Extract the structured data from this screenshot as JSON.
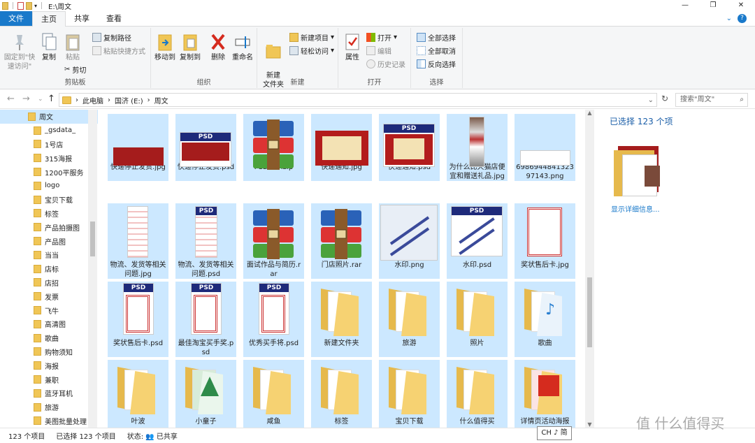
{
  "titlebar": {
    "title": "E:\\周文"
  },
  "tabs": [
    "文件",
    "主页",
    "共享",
    "查看"
  ],
  "ribbon": {
    "clipboard": {
      "label": "剪贴板",
      "pin": "固定到\"快速访问\"",
      "copy": "复制",
      "paste": "粘贴",
      "copy_path": "复制路径",
      "paste_shortcut": "粘贴快捷方式",
      "cut": "剪切"
    },
    "organize": {
      "label": "组织",
      "move_to": "移动到",
      "copy_to": "复制到",
      "delete": "删除",
      "rename": "重命名"
    },
    "new": {
      "label": "新建",
      "new_folder": "新建\n文件夹",
      "new_item": "新建项目",
      "easy_access": "轻松访问"
    },
    "open": {
      "label": "打开",
      "properties": "属性",
      "open": "打开",
      "edit": "编辑",
      "history": "历史记录"
    },
    "select": {
      "label": "选择",
      "select_all": "全部选择",
      "select_none": "全部取消",
      "invert": "反向选择"
    }
  },
  "address": {
    "crumbs": [
      "此电脑",
      "国济 (E:)",
      "周文"
    ],
    "search_placeholder": "搜索\"周文\""
  },
  "sidebar": {
    "root": "周文",
    "items": [
      "_gsdata_",
      "1号店",
      "315海报",
      "1200平服务",
      "logo",
      "宝贝下载",
      "标签",
      "产品拍摄图",
      "产品图",
      "当当",
      "店标",
      "店招",
      "发票",
      "飞牛",
      "高清图",
      "歌曲",
      "购物须知",
      "海报",
      "兼职",
      "蓝牙耳机",
      "旅游",
      "美图批量处理"
    ]
  },
  "files": [
    {
      "name": "快递停止发货.jpg",
      "type": "redbanner"
    },
    {
      "name": "快递停止发货.psd",
      "type": "psd-red"
    },
    {
      "name": "PS2017.zip",
      "type": "rar"
    },
    {
      "name": "快递通知.jpg",
      "type": "notice"
    },
    {
      "name": "快递通知.psd",
      "type": "psd-notice"
    },
    {
      "name": "为什么比天猫店便宜和赠送礼品.jpg",
      "type": "longimg"
    },
    {
      "name": "698694484132397143.png",
      "type": "smallimg"
    },
    {
      "name": "物流、发货等相关问题.jpg",
      "type": "doc"
    },
    {
      "name": "物流、发货等相关问题.psd",
      "type": "psd-doc"
    },
    {
      "name": "面试作品与简历.rar",
      "type": "rar"
    },
    {
      "name": "门店照片.rar",
      "type": "rar"
    },
    {
      "name": "水印.png",
      "type": "watermark"
    },
    {
      "name": "水印.psd",
      "type": "psd-watermark"
    },
    {
      "name": "奖状售后卡.jpg",
      "type": "cert"
    },
    {
      "name": "奖状售后卡.psd",
      "type": "psd-cert"
    },
    {
      "name": "最佳淘宝买手奖.psd",
      "type": "psd-cert"
    },
    {
      "name": "优秀买手将.psd",
      "type": "psd-cert"
    },
    {
      "name": "新建文件夹",
      "type": "folder"
    },
    {
      "name": "旅游",
      "type": "folder"
    },
    {
      "name": "照片",
      "type": "folder"
    },
    {
      "name": "歌曲",
      "type": "folder-music"
    },
    {
      "name": "叶波",
      "type": "folder"
    },
    {
      "name": "小童子",
      "type": "folder-green"
    },
    {
      "name": "咸鱼",
      "type": "folder"
    },
    {
      "name": "标签",
      "type": "folder"
    },
    {
      "name": "宝贝下载",
      "type": "folder"
    },
    {
      "name": "什么值得买",
      "type": "folder"
    },
    {
      "name": "详情页活动海报",
      "type": "folder-red"
    }
  ],
  "preview": {
    "count": "已选择 123 个项",
    "details": "显示详细信息..."
  },
  "status": {
    "items": "123 个项目",
    "selected": "已选择 123 个项目",
    "state_label": "状态:",
    "shared": "已共享"
  },
  "ime": "CH ♪ 简",
  "watermark": "值 什么值得买"
}
